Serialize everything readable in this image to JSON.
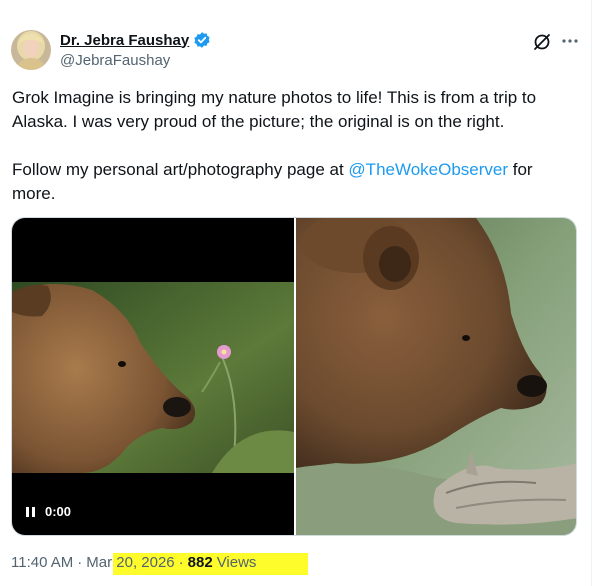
{
  "author": {
    "name": "Dr. Jebra Faushay",
    "handle": "@JebraFaushay"
  },
  "tweet": {
    "line1": "Grok Imagine is bringing my nature photos to life! This is from a trip to Alaska. I was very proud of the picture; the original is on the right.",
    "line2_prefix": "Follow my personal art/photography page at ",
    "mention": "@TheWokeObserver",
    "line2_suffix": " for more."
  },
  "video": {
    "time": "0:00"
  },
  "meta": {
    "time": "11:40 AM",
    "date": "Mar 20, 2026",
    "views_count": "882",
    "views_label": "Views"
  },
  "colors": {
    "link": "#1d9bf0",
    "verified": "#1d9bf0",
    "highlight": "#fffc2b",
    "secondary_text": "#536471"
  },
  "icons": [
    "verified-badge-icon",
    "grok-icon",
    "more-options-icon",
    "pause-icon"
  ]
}
